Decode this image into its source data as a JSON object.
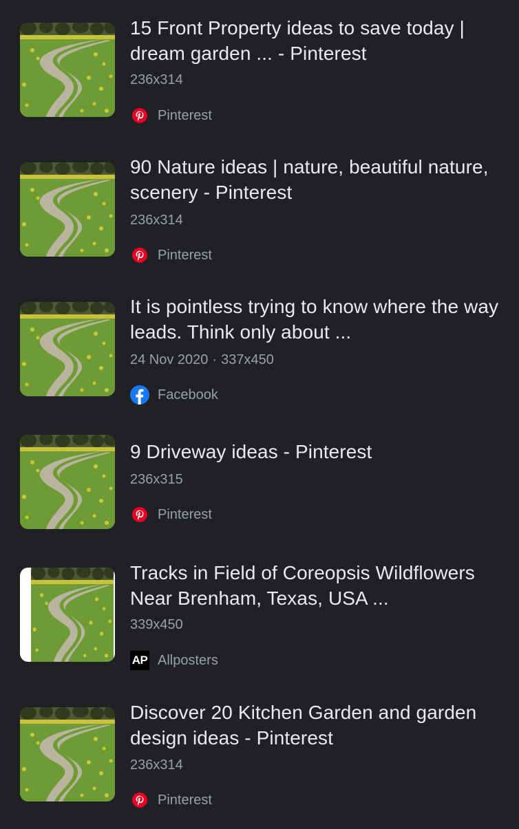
{
  "results": [
    {
      "title": "15 Front Property ideas to save today | dream garden ... - Pinterest",
      "meta": "236x314",
      "date": "",
      "source": "Pinterest",
      "source_icon": "pinterest-icon"
    },
    {
      "title": "90 Nature ideas | nature, beautiful nature, scenery - Pinterest",
      "meta": "236x314",
      "date": "",
      "source": "Pinterest",
      "source_icon": "pinterest-icon"
    },
    {
      "title": "It is pointless trying to know where the way leads. Think only about ...",
      "meta": "337x450",
      "date": "24 Nov 2020",
      "source": "Facebook",
      "source_icon": "facebook-icon"
    },
    {
      "title": "9 Driveway ideas - Pinterest",
      "meta": "236x315",
      "date": "",
      "source": "Pinterest",
      "source_icon": "pinterest-icon"
    },
    {
      "title": "Tracks in Field of Coreopsis Wildflowers Near Brenham, Texas, USA ...",
      "meta": "339x450",
      "date": "",
      "source": "Allposters",
      "source_icon": "allposters-icon",
      "source_logo_text": "AP"
    },
    {
      "title": "Discover 20 Kitchen Garden and garden design ideas - Pinterest",
      "meta": "236x314",
      "date": "",
      "source": "Pinterest",
      "source_icon": "pinterest-icon"
    }
  ],
  "colors": {
    "background": "#202124",
    "title": "#e8eaed",
    "secondary": "#9aa0a6",
    "pinterest": "#e60023",
    "facebook": "#1877f2"
  }
}
